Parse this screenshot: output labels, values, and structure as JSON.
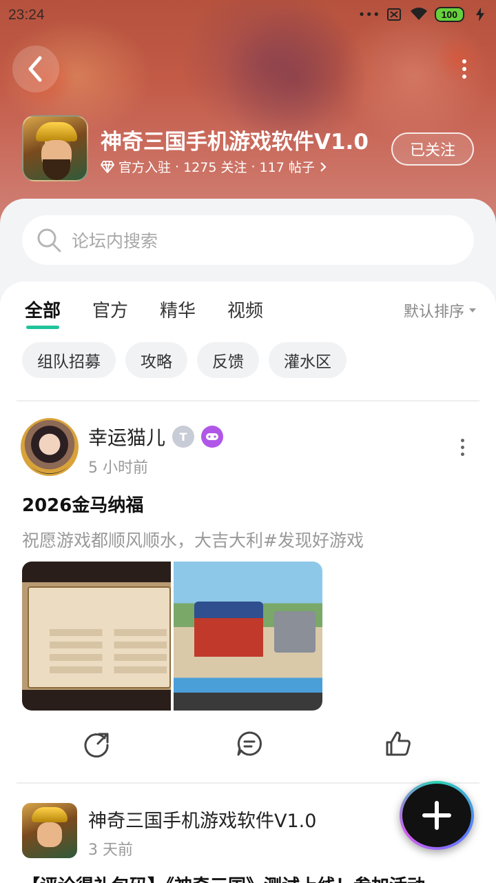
{
  "status_bar": {
    "time": "23:24",
    "battery": "100",
    "icons": [
      "dots-icon",
      "sim-off-icon",
      "wifi-icon",
      "battery-icon",
      "charging-icon"
    ]
  },
  "header": {
    "app_title": "神奇三国手机游戏软件V1.0",
    "official_label": "官方入驻",
    "followers": "1275 关注",
    "posts": "117 帖子",
    "follow_button": "已关注"
  },
  "search": {
    "placeholder": "论坛内搜索"
  },
  "tabs": [
    {
      "label": "全部",
      "active": true
    },
    {
      "label": "官方",
      "active": false
    },
    {
      "label": "精华",
      "active": false
    },
    {
      "label": "视频",
      "active": false
    }
  ],
  "sort_label": "默认排序",
  "chips": [
    "组队招募",
    "攻略",
    "反馈",
    "灌水区"
  ],
  "posts": [
    {
      "author": "幸运猫儿",
      "time": "5 小时前",
      "title": "2026金马纳福",
      "body": "祝愿游戏都顺风顺水，大吉大利#发现好游戏"
    },
    {
      "author": "神奇三国手机游戏软件V1.0",
      "time": "3 天前",
      "title": "【评论得礼包码】《神奇三国》测试上线！参加活动"
    }
  ],
  "colors": {
    "accent": "#20c39a",
    "banner": "#c25a46"
  }
}
